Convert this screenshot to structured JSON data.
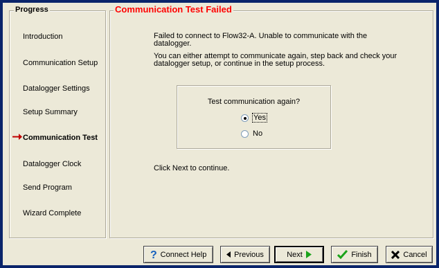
{
  "progress": {
    "title": "Progress",
    "steps": [
      {
        "label": "Introduction"
      },
      {
        "label": "Communication Setup"
      },
      {
        "label": "Datalogger Settings"
      },
      {
        "label": "Setup Summary"
      },
      {
        "label": "Communication Test",
        "current": true
      },
      {
        "label": "Datalogger Clock"
      },
      {
        "label": "Send Program"
      },
      {
        "label": "Wizard Complete"
      }
    ]
  },
  "main": {
    "title": "Communication Test Failed",
    "message_line1": "Failed to connect to Flow32-A.  Unable to communicate with the",
    "message_line2": "datalogger.",
    "message_line3": "You can either attempt to communicate again, step back and check your",
    "message_line4": "datalogger setup, or continue in the setup process.",
    "question": "Test communication again?",
    "options": [
      {
        "label": "Yes",
        "selected": true
      },
      {
        "label": "No",
        "selected": false
      }
    ],
    "footer_note": "Click Next to continue."
  },
  "buttons": {
    "connect_help": "Connect Help",
    "previous": "Previous",
    "next": "Next",
    "finish": "Finish",
    "cancel": "Cancel"
  },
  "colors": {
    "title_red": "#ff0000",
    "window_edge": "#0a246a",
    "face": "#ece9d8"
  }
}
